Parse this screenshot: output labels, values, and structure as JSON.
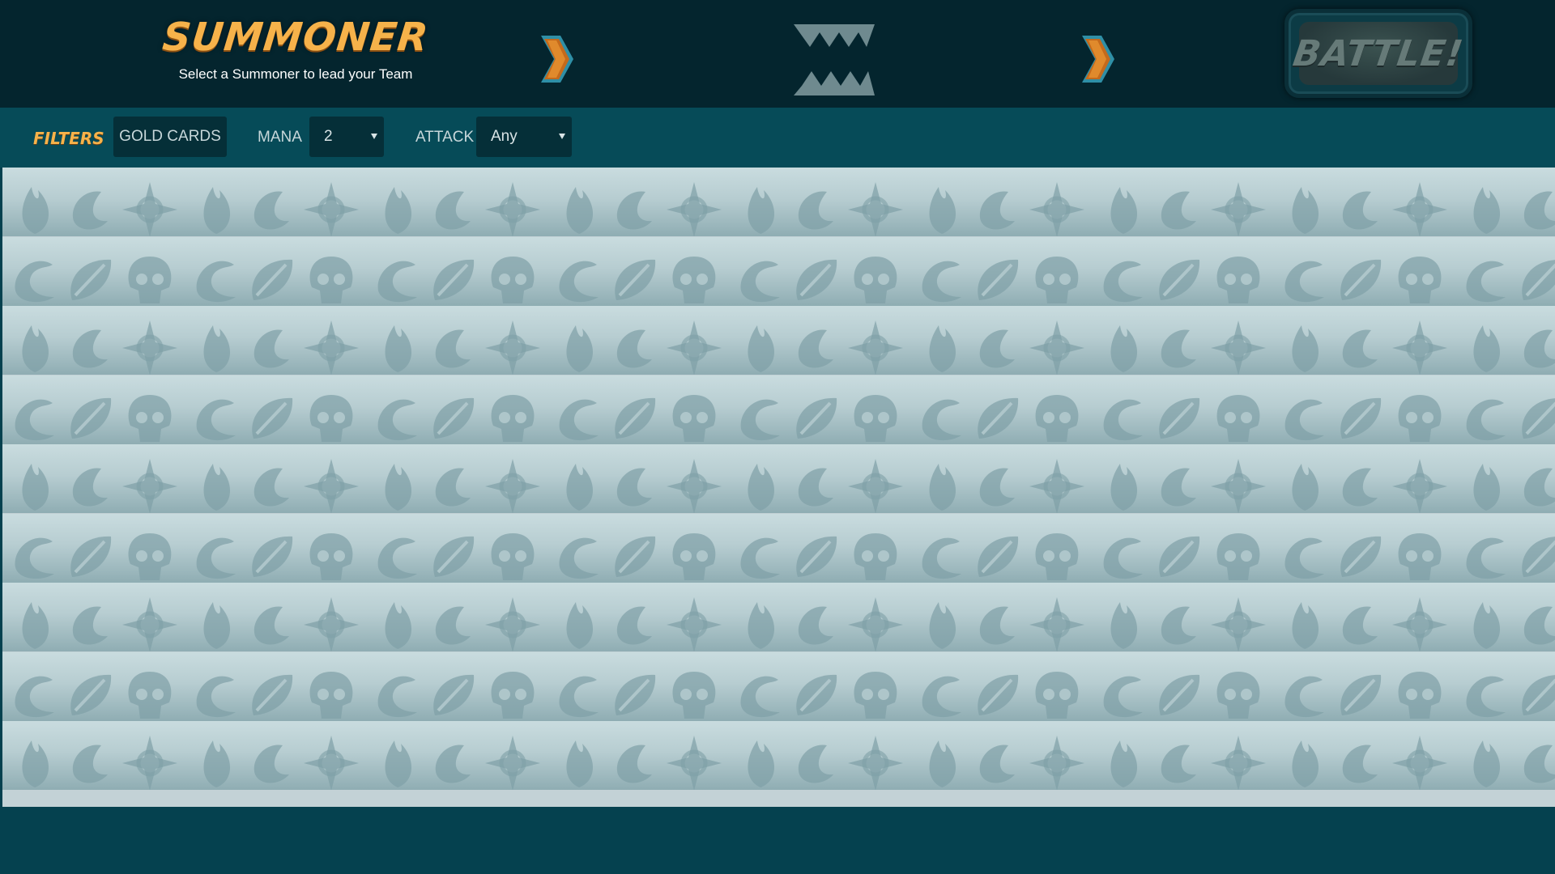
{
  "header": {
    "step_title": "SUMMONER",
    "step_subtitle": "Select a Summoner to lead your Team",
    "battle_label": "BATTLE!",
    "icons": {
      "next": "chevron-right-icon",
      "monsters": "monster-teeth-icon"
    }
  },
  "filters": {
    "label": "FILTERS",
    "gold_cards_label": "GOLD CARDS",
    "mana_label": "MANA",
    "mana_value": "2",
    "attack_label": "ATTACK",
    "attack_value": "Any"
  },
  "card_grid": {
    "row_count": 9,
    "row_patterns": [
      "fire-water-stars",
      "waves-leaf-skull",
      "fire-water-stars",
      "waves-leaf-skull",
      "fire-water-stars",
      "waves-leaf-skull",
      "fire-water-stars",
      "waves-leaf-skull",
      "fire-water-stars"
    ]
  },
  "colors": {
    "header_bg": "#04252e",
    "filter_bg": "#064b58",
    "accent_orange": "#f6b24a",
    "row_light": "#c9dcdf",
    "row_dark": "#8fadb3"
  }
}
